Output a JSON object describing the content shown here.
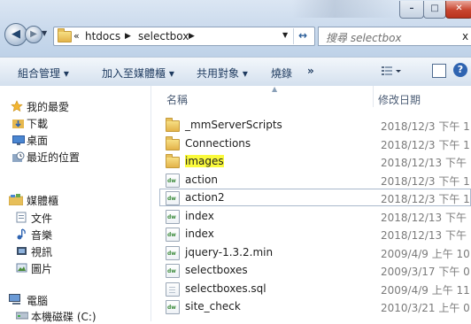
{
  "address_bar": {
    "overflow": "«",
    "crumbs": [
      "htdocs",
      "selectbox"
    ],
    "separator": "▶",
    "dropdown": "▼",
    "refresh": "↔"
  },
  "search": {
    "placeholder": "搜尋 selectbox",
    "extra": "ⅹ"
  },
  "window": {
    "minimize": "–",
    "maximize": "□",
    "close": "✕"
  },
  "nav_buttons": {
    "back": "◀",
    "forward": "▶",
    "history": "▼"
  },
  "toolbar": {
    "organize": "組合管理 ▾",
    "add_to_library": "加入至媒體櫃 ▾",
    "share_with": "共用對象 ▾",
    "burn": "燒錄",
    "more": "»",
    "help": "?"
  },
  "nav_pane": {
    "favorites": "我的最愛",
    "downloads": "下載",
    "desktop": "桌面",
    "recent": "最近的位置",
    "libraries": "媒體櫃",
    "documents": "文件",
    "music": "音樂",
    "videos": "視訊",
    "pictures": "圖片",
    "computer": "電腦",
    "local_disk": "本機磁碟 (C:)"
  },
  "columns": {
    "name": "名稱",
    "date_modified": "修改日期"
  },
  "files": [
    {
      "name": "_mmServerScripts",
      "date": "2018/12/3 下午 1.",
      "icon": "folder"
    },
    {
      "name": "Connections",
      "date": "2018/12/3 下午 1.",
      "icon": "folder"
    },
    {
      "name": "images",
      "date": "2018/12/13 下午 .",
      "icon": "folder",
      "highlight": true
    },
    {
      "name": "action",
      "date": "2018/12/3 下午 1.",
      "icon": "dw"
    },
    {
      "name": "action2",
      "date": "2018/12/3 下午 1.",
      "icon": "dw",
      "focused": true
    },
    {
      "name": "index",
      "date": "2018/12/13 下午 .",
      "icon": "dw"
    },
    {
      "name": "index",
      "date": "2018/12/13 下午 .",
      "icon": "dw"
    },
    {
      "name": "jquery-1.3.2.min",
      "date": "2009/4/9 上午 10.",
      "icon": "dw"
    },
    {
      "name": "selectboxes",
      "date": "2009/3/17 下午 0.",
      "icon": "dw"
    },
    {
      "name": "selectboxes.sql",
      "date": "2009/4/9 上午 11.",
      "icon": "plain"
    },
    {
      "name": "site_check",
      "date": "2010/3/21 上午 0.",
      "icon": "dw"
    }
  ]
}
